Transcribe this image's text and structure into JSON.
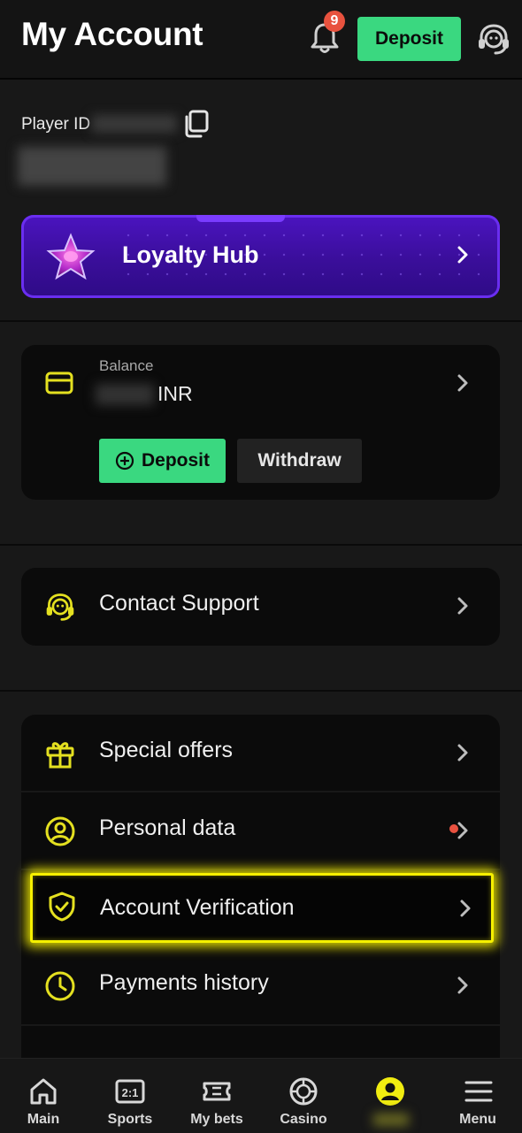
{
  "header": {
    "title": "My Account",
    "notification_count": "9",
    "deposit_label": "Deposit"
  },
  "profile": {
    "player_id_label": "Player ID"
  },
  "loyalty": {
    "label": "Loyalty Hub"
  },
  "balance": {
    "label": "Balance",
    "currency": "INR",
    "deposit_label": "Deposit",
    "withdraw_label": "Withdraw"
  },
  "support": {
    "label": "Contact Support"
  },
  "menu": {
    "items": [
      {
        "label": "Special offers",
        "icon": "gift-icon"
      },
      {
        "label": "Personal data",
        "icon": "user-circle-icon",
        "has_alert": true
      },
      {
        "label": "Account Verification",
        "icon": "shield-check-icon",
        "highlighted": true
      },
      {
        "label": "Payments history",
        "icon": "clock-icon"
      }
    ]
  },
  "bottom_nav": {
    "items": [
      {
        "label": "Main",
        "icon": "home-icon"
      },
      {
        "label": "Sports",
        "icon": "odds-icon",
        "icon_text": "2:1"
      },
      {
        "label": "My bets",
        "icon": "ticket-icon"
      },
      {
        "label": "Casino",
        "icon": "chip-icon"
      },
      {
        "label": "",
        "icon": "account-icon",
        "active": true
      },
      {
        "label": "Menu",
        "icon": "hamburger-icon"
      }
    ]
  },
  "colors": {
    "accent_green": "#3ad880",
    "accent_yellow": "#e4e020",
    "highlight_yellow": "#f6f000",
    "loyalty_purple": "#4b14c0",
    "badge_red": "#e8523e"
  }
}
